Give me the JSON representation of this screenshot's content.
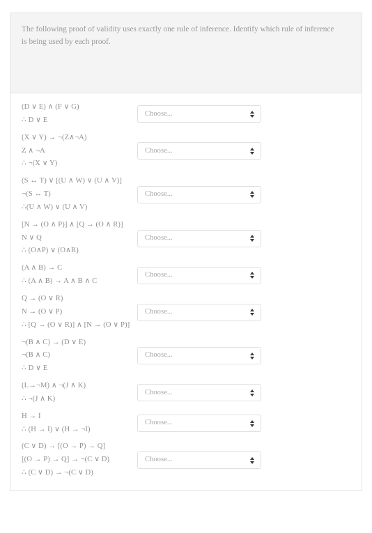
{
  "instructions": {
    "text": "The following proof of validity uses exactly one rule of inference. Identify which rule of inference is being used by each proof."
  },
  "select": {
    "placeholder": "Choose...",
    "icon": "updown-spinner-icon"
  },
  "colors": {
    "panel_background": "#f4f4f4",
    "card_background": "#ffffff",
    "text": "#8f8f8f",
    "border": "#e3e3e3"
  },
  "proofs": [
    {
      "id": 1,
      "lines": [
        "(D ∨ E) ∧ (F ∨ G)",
        "∴ D ∨ E"
      ],
      "answer": "Choose..."
    },
    {
      "id": 2,
      "lines": [
        "(X ∨ Y) → ¬(Z∧¬A)",
        "Z ∧ ¬A",
        "∴ ¬(X ∨ Y)"
      ],
      "answer": "Choose..."
    },
    {
      "id": 3,
      "lines": [
        "(S ↔ T) ∨ [(U ∧ W) ∨ (U ∧ V)]",
        "¬(S ↔ T)",
        "∴(U ∧ W) ∨ (U ∧ V)"
      ],
      "answer": "Choose..."
    },
    {
      "id": 4,
      "lines": [
        "[N → (O ∧ P)] ∧ [Q → (O ∧ R)]",
        "N ∨ Q",
        "∴ (O∧P) ∨ (O∧R)"
      ],
      "answer": "Choose..."
    },
    {
      "id": 5,
      "lines": [
        "(A ∧ B) → C",
        "∴ (A ∧ B) → A ∧ B ∧ C"
      ],
      "answer": "Choose..."
    },
    {
      "id": 6,
      "lines": [
        "Q → (O ∨ R)",
        "N → (O ∨ P)",
        "∴ [Q → (O ∨ R)] ∧ [N → (O ∨ P)]"
      ],
      "answer": "Choose..."
    },
    {
      "id": 7,
      "lines": [
        "¬(B ∧ C) → (D ∨ E)",
        "¬(B ∧ C)",
        "∴ D ∨ E"
      ],
      "answer": "Choose..."
    },
    {
      "id": 8,
      "lines": [
        "(L→¬M) ∧ ¬(J ∧ K)",
        "∴ ¬(J ∧ K)"
      ],
      "answer": "Choose..."
    },
    {
      "id": 9,
      "lines": [
        "H → I",
        "∴ (H → I) ∨ (H → ¬I)"
      ],
      "answer": "Choose..."
    },
    {
      "id": 10,
      "lines": [
        "(C ∨ D) → [(O → P) → Q]",
        "[(O → P) → Q] → ¬(C ∨ D)",
        "∴ (C ∨ D) → ¬(C ∨ D)"
      ],
      "answer": "Choose..."
    }
  ]
}
